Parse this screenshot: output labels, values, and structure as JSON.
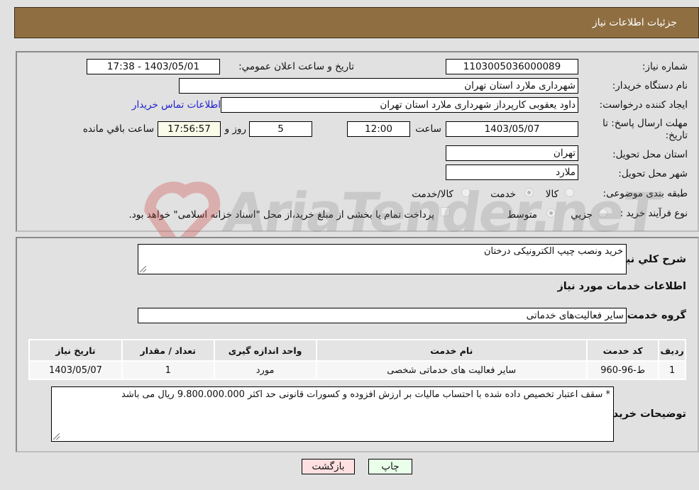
{
  "header": {
    "title": "جزئیات اطلاعات نیاز"
  },
  "details": {
    "need_number": {
      "label": "شماره نیاز:",
      "value": "1103005036000089"
    },
    "announce_datetime": {
      "label": "تاریخ و ساعت اعلان عمومي:",
      "value": "1403/05/01 - 17:38"
    },
    "buyer_org": {
      "label": "نام دستگاه خریدار:",
      "value": "شهرداری ملارد استان تهران"
    },
    "requester": {
      "label": "ایجاد کننده درخواست:",
      "value": "داود یعقوبی کارپرداز  شهرداری ملارد استان تهران"
    },
    "buyer_contact_link": "اطلاعات تماس خریدار",
    "deadline": {
      "label_line1": "مهلت ارسال پاسخ: تا",
      "label_line2": "تاریخ:",
      "date": "1403/05/07",
      "time_label": "ساعت",
      "time": "12:00",
      "days": "5",
      "days_label": "روز و",
      "remaining": "17:56:57",
      "remaining_label": "ساعت باقي مانده"
    },
    "delivery_province": {
      "label": "استان محل تحویل:",
      "value": "تهران"
    },
    "delivery_city": {
      "label": "شهر محل تحویل:",
      "value": "ملارد"
    },
    "category": {
      "label": "طبقه بندی موضوعی:",
      "options": [
        "کالا",
        "خدمت",
        "کالا/خدمت"
      ],
      "selected": "خدمت"
    },
    "purchase_process": {
      "label": "نوع فرآیند خرید :",
      "options": [
        "جزیي",
        "متوسط"
      ],
      "selected": "متوسط",
      "treasury_note": "پرداخت تمام یا بخشی از مبلغ خرید،از محل \"اسناد خزانه اسلامی\" خواهد بود."
    }
  },
  "description": {
    "label": "شرح کلي نیاز:",
    "value": "خرید ونصب چیپ الکترونیکی درختان"
  },
  "services_section": {
    "title": "اطلاعات خدمات مورد نیاز",
    "group_label": "گروه خدمت:",
    "group_value": "سایر فعالیت‌های خدماتی",
    "table": {
      "columns": [
        "ردیف",
        "کد خدمت",
        "نام خدمت",
        "واحد اندازه گیری",
        "تعداد / مقدار",
        "تاریخ نیاز"
      ],
      "rows": [
        [
          "1",
          "ط-96-960",
          "سایر فعالیت های خدماتی شخصی",
          "مورد",
          "1",
          "1403/05/07"
        ]
      ]
    }
  },
  "buyer_notes": {
    "label": "توضیحات خریدار:",
    "value": "* سقف اعتبار تخصیص داده شده با احتساب مالیات بر ارزش افزوده و کسورات قانونی حد اکثر 9.800.000.000  ریال می باشد"
  },
  "buttons": {
    "print": "چاپ",
    "back": "بازگشت"
  },
  "watermark": "AriaTender.neT",
  "colors": {
    "header_bg": "#8f6f42",
    "link": "#2020d0",
    "print_bg": "#eaffea",
    "back_bg": "#ffe0e0",
    "remaining_bg": "#fbfbe9"
  }
}
